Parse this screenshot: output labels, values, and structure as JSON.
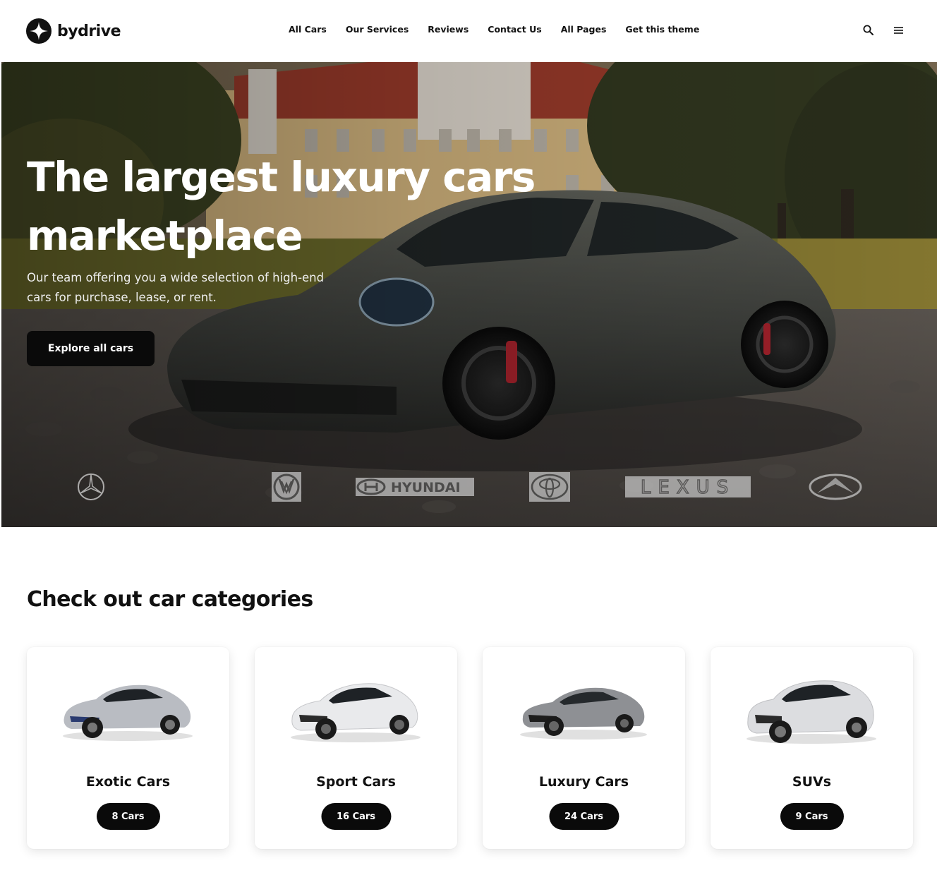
{
  "brand": {
    "name": "bydrive"
  },
  "nav": {
    "items": [
      "All Cars",
      "Our Services",
      "Reviews",
      "Contact Us",
      "All Pages",
      "Get this theme"
    ]
  },
  "header_icons": [
    "search-icon",
    "menu-icon"
  ],
  "hero": {
    "title": "The largest luxury cars marketplace",
    "subtitle": "Our team offering you a wide selection of high-end cars for purchase, lease, or rent.",
    "cta": "Explore all cars",
    "brand_logos": [
      {
        "icon": "mercedes-logo"
      },
      {
        "icon": "volkswagen-logo"
      },
      {
        "icon": "hyundai-logo",
        "text": "HYUNDAI"
      },
      {
        "icon": "toyota-logo"
      },
      {
        "icon": "lexus-logo",
        "text": "LEXUS"
      },
      {
        "icon": "infiniti-logo"
      }
    ]
  },
  "categories": {
    "title": "Check out car categories",
    "items": [
      {
        "name": "Exotic Cars",
        "count": "8 Cars",
        "icon": "exotic-car-image",
        "color": "#b9bcc2"
      },
      {
        "name": "Sport Cars",
        "count": "16 Cars",
        "icon": "sport-car-image",
        "color": "#e9eaec"
      },
      {
        "name": "Luxury Cars",
        "count": "24 Cars",
        "icon": "luxury-car-image",
        "color": "#8e9094"
      },
      {
        "name": "SUVs",
        "count": "9 Cars",
        "icon": "suv-image",
        "color": "#dcdde0"
      }
    ]
  },
  "colors": {
    "accent": "#0a0a0a",
    "background": "#ffffff",
    "text": "#111111"
  }
}
